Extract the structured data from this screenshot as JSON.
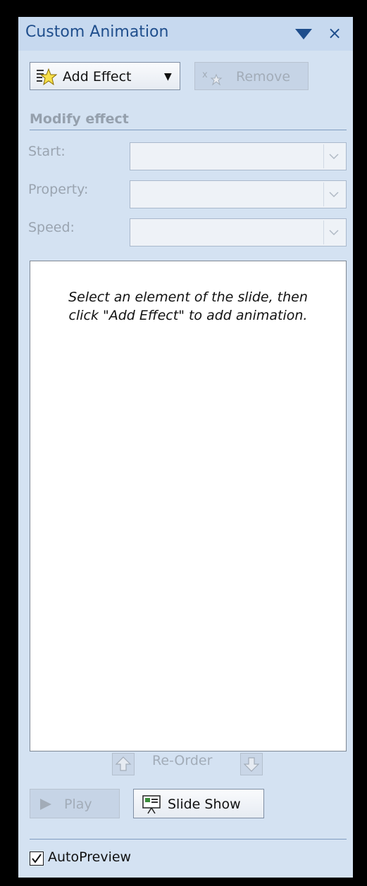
{
  "pane": {
    "title": "Custom Animation",
    "menu_icon": "triangle-down-icon",
    "close_icon": "close-x-icon",
    "close_glyph": "×"
  },
  "toolbar": {
    "add_effect_label": "Add Effect",
    "add_effect_icon": "star-effect-icon",
    "add_effect_arrow": "▼",
    "remove_label": "Remove",
    "remove_icon": "remove-effect-icon",
    "remove_enabled": false
  },
  "modify_effect": {
    "section_title": "Modify effect",
    "fields": [
      {
        "label": "Start:",
        "value": "",
        "enabled": false
      },
      {
        "label": "Property:",
        "value": "",
        "enabled": false
      },
      {
        "label": "Speed:",
        "value": "",
        "enabled": false
      }
    ]
  },
  "effect_list": {
    "hint_line1": "Select an element of the slide, then",
    "hint_line2": "click \"Add Effect\" to add animation."
  },
  "reorder": {
    "label": "Re-Order",
    "up_icon": "arrow-up-icon",
    "down_icon": "arrow-down-icon",
    "enabled": false
  },
  "playback": {
    "play_label": "Play",
    "play_icon": "play-icon",
    "play_enabled": false,
    "slideshow_label": "Slide Show",
    "slideshow_icon": "slide-show-icon"
  },
  "autopreview": {
    "label": "AutoPreview",
    "checked": true
  },
  "colors": {
    "pane_background": "#d4e2f2",
    "title_text": "#1f4e8c",
    "disabled_text": "#a2acb8"
  }
}
